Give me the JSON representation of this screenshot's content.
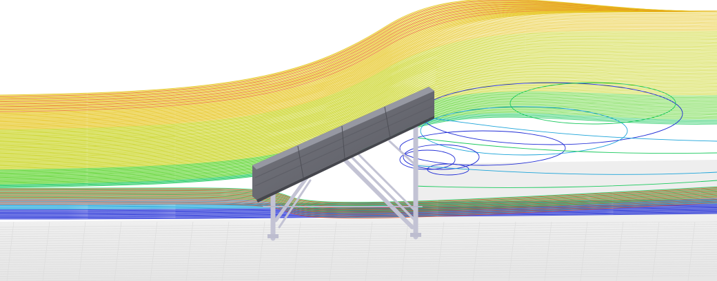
{
  "scene": {
    "kind": "cfd-streamline-visualization",
    "subject": "tilted-solar-panel-on-frame",
    "background_color": "#ffffff",
    "ground_color": "#ececec",
    "panel_color": "#6f7078",
    "frame_color": "#c9c9da",
    "streamline_colors": [
      "#1f2bd6",
      "#1aa3d9",
      "#19c95c",
      "#5ad32a",
      "#c9d41f",
      "#e6c51f",
      "#e8731d",
      "#e0461a"
    ]
  }
}
